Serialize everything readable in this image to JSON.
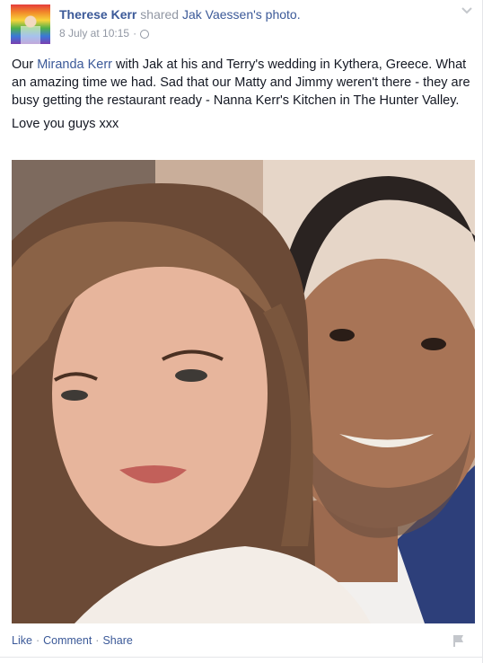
{
  "post": {
    "author": "Therese Kerr",
    "shared_text": "shared",
    "owner_name": "Jak Vaessen's",
    "owner_suffix": "photo.",
    "date": "8 July at 10:15",
    "separator": "·",
    "paragraph1": {
      "before_link": "Our ",
      "link": "Miranda Kerr",
      "after_link": " with Jak at his and Terry's wedding in Kythera, Greece. What an amazing time we had. Sad that our Matty and Jimmy weren't there - they are busy getting the restaurant ready - Nanna Kerr's Kitchen in The Hunter Valley."
    },
    "paragraph2": "Love you guys xxx"
  },
  "actions": {
    "like": "Like",
    "comment": "Comment",
    "share": "Share",
    "dot": "·"
  },
  "icons": {
    "audience": "globe-icon",
    "options": "chevron-down-icon",
    "report": "flag-icon"
  },
  "colors": {
    "link": "#3b5998",
    "meta": "#9197a3",
    "text": "#141823"
  }
}
